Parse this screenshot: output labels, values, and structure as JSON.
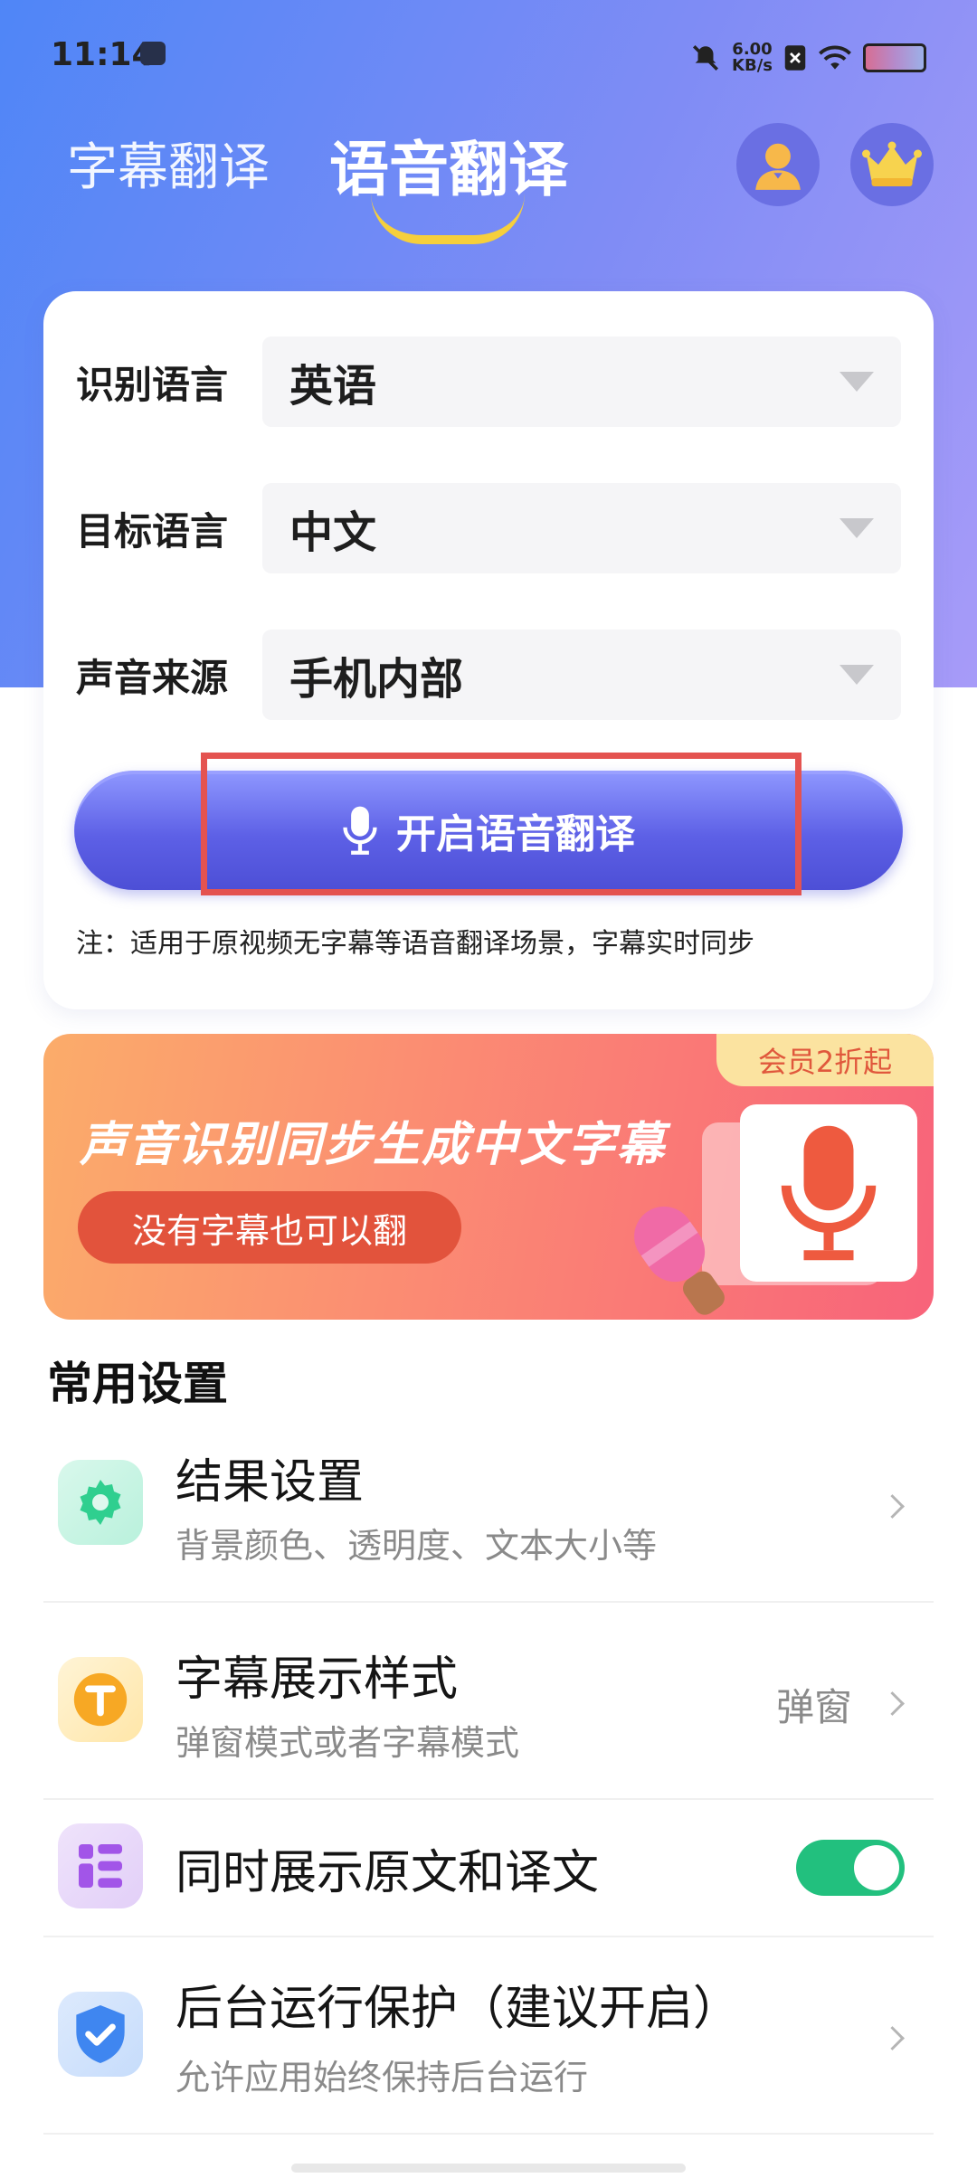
{
  "status_bar": {
    "time": "11:14",
    "speed_value": "6.00",
    "speed_unit": "KB/s"
  },
  "tabs": [
    {
      "label": "字幕翻译",
      "active": false
    },
    {
      "label": "语音翻译",
      "active": true
    }
  ],
  "header_icons": [
    "user-avatar-icon",
    "vip-crown-icon"
  ],
  "form": {
    "rows": [
      {
        "label": "识别语言",
        "value": "英语"
      },
      {
        "label": "目标语言",
        "value": "中文"
      },
      {
        "label": "声音来源",
        "value": "手机内部"
      }
    ],
    "start_button": "开启语音翻译",
    "note": "注：适用于原视频无字幕等语音翻译场景，字幕实时同步"
  },
  "banner": {
    "badge": "会员2折起",
    "title": "声音识别同步生成中文字幕",
    "pill": "没有字幕也可以翻"
  },
  "settings": {
    "title": "常用设置",
    "items": [
      {
        "title": "结果设置",
        "subtitle": "背景颜色、透明度、文本大小等",
        "icon": "gear-icon",
        "value": ""
      },
      {
        "title": "字幕展示样式",
        "subtitle": "弹窗模式或者字幕模式",
        "icon": "text-t-icon",
        "value": "弹窗"
      },
      {
        "title": "同时展示原文和译文",
        "subtitle": "",
        "icon": "layout-grid-icon",
        "toggle_on": true
      },
      {
        "title": "后台运行保护（建议开启）",
        "subtitle": "允许应用始终保持后台运行",
        "icon": "shield-check-icon",
        "value": ""
      }
    ]
  },
  "colors": {
    "primary": "#5d60e6",
    "toggle_on": "#22c07e",
    "highlight": "#e45350",
    "tab_underline": "#f6cf3c"
  }
}
